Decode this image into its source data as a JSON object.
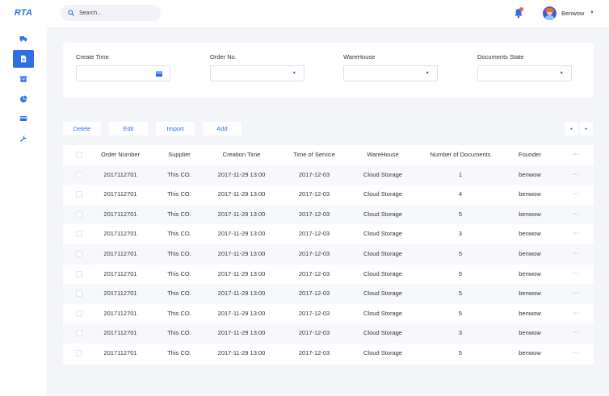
{
  "app": {
    "logo": "RTA"
  },
  "sidebar": {
    "items": [
      {
        "name": "truck-icon",
        "active": false
      },
      {
        "name": "document-icon",
        "active": true
      },
      {
        "name": "archive-icon",
        "active": false
      },
      {
        "name": "pie-chart-icon",
        "active": false
      },
      {
        "name": "card-icon",
        "active": false
      },
      {
        "name": "wrench-icon",
        "active": false
      }
    ]
  },
  "header": {
    "search": {
      "placeholder": "Search..."
    },
    "user": {
      "name": "Benwow"
    }
  },
  "filters": {
    "create_time": {
      "label": "Create Time"
    },
    "order_no": {
      "label": "Order No."
    },
    "warehouse": {
      "label": "WareHouse"
    },
    "documents_state": {
      "label": "Documents State"
    }
  },
  "toolbar": {
    "delete_label": "Delete",
    "edit_label": "Edit",
    "import_label": "Import",
    "add_label": "Add",
    "prev_label": "◂",
    "next_label": "▸"
  },
  "table": {
    "columns": [
      "Order Number",
      "Supplier",
      "Creation Time",
      "Time of Service",
      "WareHouse",
      "Number of Documents",
      "Founder",
      "···"
    ],
    "rows": [
      {
        "order": "2017112701",
        "supplier": "This CO.",
        "created": "2017-11-29  13:00",
        "service": "2017-12-03",
        "warehouse": "Cloud Storage",
        "docs": "1",
        "founder": "benwow",
        "more": "···"
      },
      {
        "order": "2017112701",
        "supplier": "This CO.",
        "created": "2017-11-29  13:00",
        "service": "2017-12-03",
        "warehouse": "Cloud Storage",
        "docs": "4",
        "founder": "benwow",
        "more": "···"
      },
      {
        "order": "2017112701",
        "supplier": "This CO.",
        "created": "2017-11-29  13:00",
        "service": "2017-12-03",
        "warehouse": "Cloud Storage",
        "docs": "5",
        "founder": "benwow",
        "more": "···"
      },
      {
        "order": "2017112701",
        "supplier": "This CO.",
        "created": "2017-11-29  13:00",
        "service": "2017-12-03",
        "warehouse": "Cloud Storage",
        "docs": "3",
        "founder": "benwow",
        "more": "···"
      },
      {
        "order": "2017112701",
        "supplier": "This CO.",
        "created": "2017-11-29  13:00",
        "service": "2017-12-03",
        "warehouse": "Cloud Storage",
        "docs": "5",
        "founder": "benwow",
        "more": "···"
      },
      {
        "order": "2017112701",
        "supplier": "This CO.",
        "created": "2017-11-29  13:00",
        "service": "2017-12-03",
        "warehouse": "Cloud Storage",
        "docs": "5",
        "founder": "benwow",
        "more": "···"
      },
      {
        "order": "2017112701",
        "supplier": "This CO.",
        "created": "2017-11-29  13:00",
        "service": "2017-12-03",
        "warehouse": "Cloud Storage",
        "docs": "5",
        "founder": "benwow",
        "more": "···"
      },
      {
        "order": "2017112701",
        "supplier": "This CO.",
        "created": "2017-11-29  13:00",
        "service": "2017-12-03",
        "warehouse": "Cloud Storage",
        "docs": "5",
        "founder": "benwow",
        "more": "···"
      },
      {
        "order": "2017112701",
        "supplier": "This CO.",
        "created": "2017-11-29  13:00",
        "service": "2017-12-03",
        "warehouse": "Cloud Storage",
        "docs": "3",
        "founder": "benwow",
        "more": "···"
      },
      {
        "order": "2017112701",
        "supplier": "This CO.",
        "created": "2017-11-29  13:00",
        "service": "2017-12-03",
        "warehouse": "Cloud Storage",
        "docs": "5",
        "founder": "benwow",
        "more": "···"
      }
    ]
  },
  "colors": {
    "accent": "#2f6fe4",
    "background": "#f4f5f9",
    "alt_row": "#f7f8fc",
    "notification": "#ef5b5b"
  }
}
